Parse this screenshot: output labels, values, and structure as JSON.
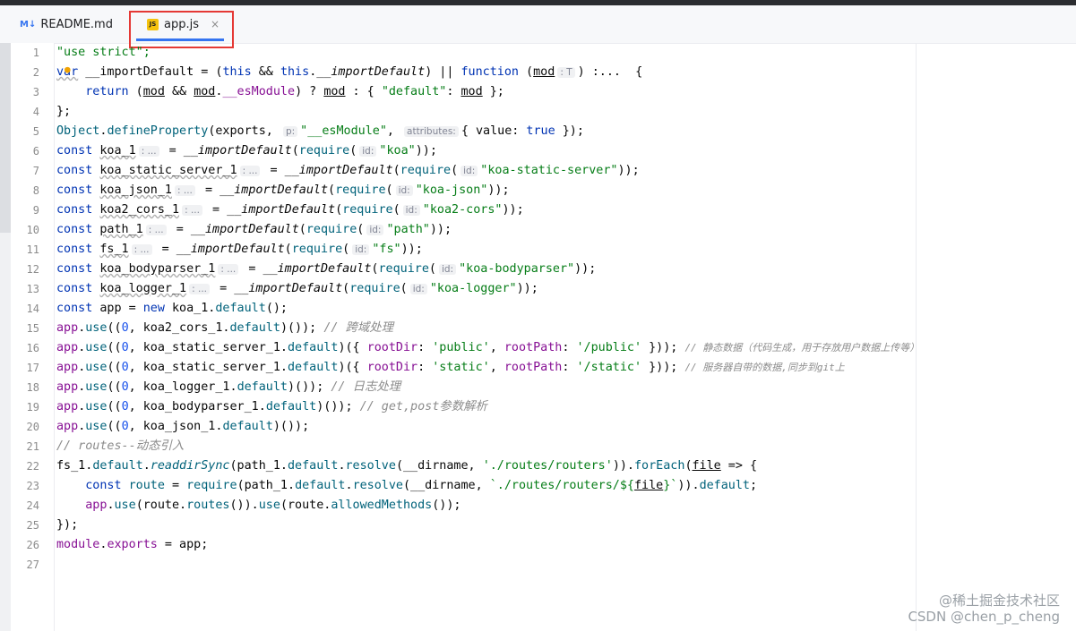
{
  "tabs": [
    {
      "icon": "markdown-icon",
      "icon_text": "M↓",
      "label": "README.md"
    },
    {
      "icon": "javascript-file-icon",
      "icon_text": "JS",
      "label": "app.js",
      "close": "×"
    }
  ],
  "gutter": {
    "numbers": [
      "1",
      "2",
      "3",
      "4",
      "5",
      "6",
      "7",
      "8",
      "9",
      "10",
      "11",
      "12",
      "13",
      "14",
      "15",
      "16",
      "17",
      "18",
      "19",
      "20",
      "21",
      "22",
      "23",
      "24",
      "25",
      "26",
      "27"
    ]
  },
  "code": {
    "l1": {
      "text": "\"use strict\";"
    },
    "l2": {
      "var": "var",
      "name": " __importDefault",
      "eq": " = (",
      "this": "this",
      "and": " && ",
      "this2": "this",
      "dot": ".",
      "prop": "__importDefault",
      "close": ") || ",
      "function": "function",
      "paren": " (",
      "param": "mod",
      "hint": ": T",
      "rest": ") :...  {"
    },
    "l3": {
      "indent": "    ",
      "return": "return",
      "a": " (",
      "mod1": "mod",
      "and": " && ",
      "mod2": "mod",
      "dot": ".",
      "prop": "__esModule",
      "b": ") ? ",
      "mod3": "mod",
      "c": " : { ",
      "str": "\"default\"",
      "d": ": ",
      "mod4": "mod",
      "e": " };"
    },
    "l4": {
      "text": "};"
    },
    "l5": {
      "obj": "Object",
      "dot": ".",
      "fn": "defineProperty",
      "a": "(exports, ",
      "hint1": "p:",
      "str": "\"__esModule\"",
      "b": ", ",
      "hint2": "attributes:",
      "c": "{ value: ",
      "true": "true",
      "d": " });"
    },
    "requires": [
      {
        "const": "const",
        "name": "koa_1",
        "hint": ": ...",
        "eq": " = ",
        "fn": "__importDefault",
        "req_open": "(",
        "req": "require",
        "id_hint": "id:",
        "str": "\"koa\"",
        "end": "));"
      },
      {
        "const": "const",
        "name": "koa_static_server_1",
        "hint": ": ...",
        "eq": " = ",
        "fn": "__importDefault",
        "req_open": "(",
        "req": "require",
        "id_hint": "id:",
        "str": "\"koa-static-server\"",
        "end": "));"
      },
      {
        "const": "const",
        "name": "koa_json_1",
        "hint": ": ...",
        "eq": " = ",
        "fn": "__importDefault",
        "req_open": "(",
        "req": "require",
        "id_hint": "id:",
        "str": "\"koa-json\"",
        "end": "));"
      },
      {
        "const": "const",
        "name": "koa2_cors_1",
        "hint": ": ...",
        "eq": " = ",
        "fn": "__importDefault",
        "req_open": "(",
        "req": "require",
        "id_hint": "id:",
        "str": "\"koa2-cors\"",
        "end": "));"
      },
      {
        "const": "const",
        "name": "path_1",
        "hint": ": ...",
        "eq": " = ",
        "fn": "__importDefault",
        "req_open": "(",
        "req": "require",
        "id_hint": "id:",
        "str": "\"path\"",
        "end": "));"
      },
      {
        "const": "const",
        "name": "fs_1",
        "hint": ": ...",
        "eq": " = ",
        "fn": "__importDefault",
        "req_open": "(",
        "req": "require",
        "id_hint": "id:",
        "str": "\"fs\"",
        "end": "));"
      },
      {
        "const": "const",
        "name": "koa_bodyparser_1",
        "hint": ": ...",
        "eq": " = ",
        "fn": "__importDefault",
        "req_open": "(",
        "req": "require",
        "id_hint": "id:",
        "str": "\"koa-bodyparser\"",
        "end": "));"
      },
      {
        "const": "const",
        "name": "koa_logger_1",
        "hint": ": ...",
        "eq": " = ",
        "fn": "__importDefault",
        "req_open": "(",
        "req": "require",
        "id_hint": "id:",
        "str": "\"koa-logger\"",
        "end": "));"
      }
    ],
    "l14": {
      "const": "const",
      "name": " app",
      "eq": " = ",
      "new": "new",
      "rest": " koa_1.",
      "fn": "default",
      "end": "();"
    },
    "l15": {
      "app": "app",
      "dot": ".",
      "use": "use",
      "a": "((",
      "zero": "0",
      "b": ", koa2_cors_1.",
      "fn": "default",
      "c": ")()); ",
      "cm": "// 跨域处理"
    },
    "l16": {
      "app": "app",
      "dot": ".",
      "use": "use",
      "a": "((",
      "zero": "0",
      "b": ", koa_static_server_1.",
      "fn": "default",
      "c": ")({ ",
      "k1": "rootDir",
      "d": ": ",
      "s1": "'public'",
      "e": ", ",
      "k2": "rootPath",
      "f": ": ",
      "s2": "'/public'",
      "g": " })); ",
      "cm": "// 静态数据（代码生成，用于存放用户数据上传等）"
    },
    "l17": {
      "app": "app",
      "dot": ".",
      "use": "use",
      "a": "((",
      "zero": "0",
      "b": ", koa_static_server_1.",
      "fn": "default",
      "c": ")({ ",
      "k1": "rootDir",
      "d": ": ",
      "s1": "'static'",
      "e": ", ",
      "k2": "rootPath",
      "f": ": ",
      "s2": "'/static'",
      "g": " })); ",
      "cm": "// 服务器自带的数据,同步到git上"
    },
    "l18": {
      "app": "app",
      "dot": ".",
      "use": "use",
      "a": "((",
      "zero": "0",
      "b": ", koa_logger_1.",
      "fn": "default",
      "c": ")()); ",
      "cm": "// 日志处理"
    },
    "l19": {
      "app": "app",
      "dot": ".",
      "use": "use",
      "a": "((",
      "zero": "0",
      "b": ", koa_bodyparser_1.",
      "fn": "default",
      "c": ")()); ",
      "cm": "// get,post参数解析"
    },
    "l20": {
      "app": "app",
      "dot": ".",
      "use": "use",
      "a": "((",
      "zero": "0",
      "b": ", koa_json_1.",
      "fn": "default",
      "c": ")());"
    },
    "l21": {
      "cm": "// routes--动态引入"
    },
    "l22": {
      "a": "fs_1.",
      "fn1": "default",
      "dot": ".",
      "fn2": "readdirSync",
      "b": "(path_1.",
      "fn3": "default",
      "c": ".",
      "fn4": "resolve",
      "d": "(__dirname, ",
      "s": "'./routes/routers'",
      "e": ")).",
      "fn5": "forEach",
      "f": "(",
      "param": "file",
      "g": " => {"
    },
    "l23": {
      "indent": "    ",
      "const": "const",
      "name": " route",
      "eq": " = ",
      "req": "require",
      "a": "(path_1.",
      "fn1": "default",
      "b": ".",
      "fn2": "resolve",
      "c": "(__dirname, ",
      "s1": "`./routes/routers/${",
      "param": "file",
      "s2": "}`",
      "d": ")).",
      "fn3": "default",
      "e": ";"
    },
    "l24": {
      "indent": "    ",
      "app": "app",
      "dot": ".",
      "use": "use",
      "a": "(route.",
      "fn1": "routes",
      "b": "()).",
      "use2": "use",
      "c": "(route.",
      "fn2": "allowedMethods",
      "d": "());"
    },
    "l25": {
      "text": "});"
    },
    "l26": {
      "module": "module",
      "dot": ".",
      "exports": "exports",
      "rest": " = app;"
    }
  },
  "watermark": {
    "line1": "@稀土掘金技术社区",
    "line2": "CSDN @chen_p_cheng"
  }
}
